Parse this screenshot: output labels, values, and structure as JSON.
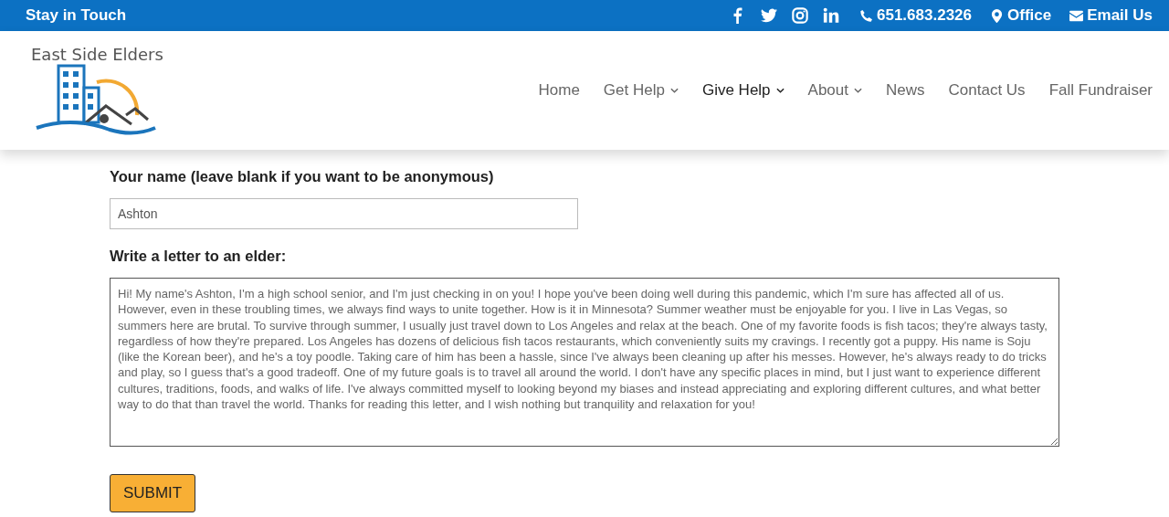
{
  "top_bar": {
    "title": "Stay in Touch",
    "social": [
      {
        "kind": "facebook"
      },
      {
        "kind": "twitter"
      },
      {
        "kind": "instagram"
      },
      {
        "kind": "linkedin"
      }
    ],
    "contacts": [
      {
        "kind": "phone",
        "label": "651.683.2326"
      },
      {
        "kind": "pin",
        "label": "Office"
      },
      {
        "kind": "mail",
        "label": "Email Us"
      }
    ]
  },
  "logo": {
    "text": "East Side Elders"
  },
  "nav": [
    {
      "label": "Home",
      "has_menu": false,
      "selected": false
    },
    {
      "label": "Get Help",
      "has_menu": true,
      "selected": false
    },
    {
      "label": "Give Help",
      "has_menu": true,
      "selected": true
    },
    {
      "label": "About",
      "has_menu": true,
      "selected": false
    },
    {
      "label": "News",
      "has_menu": false,
      "selected": false
    },
    {
      "label": "Contact Us",
      "has_menu": false,
      "selected": false
    },
    {
      "label": "Fall Fundraiser",
      "has_menu": false,
      "selected": false
    }
  ],
  "form": {
    "name_label": "Your name (leave blank if you want to be anonymous)",
    "name_value": "Ashton",
    "letter_label": "Write a letter to an elder:",
    "letter_value": "Hi! My name's Ashton, I'm a high school senior, and I'm just checking in on you! I hope you've been doing well during this pandemic, which I'm sure has affected all of us. However, even in these troubling times, we always find ways to unite together. How is it in Minnesota? Summer weather must be enjoyable for you. I live in Las Vegas, so summers here are brutal. To survive through summer, I usually just travel down to Los Angeles and relax at the beach. One of my favorite foods is fish tacos; they're always tasty, regardless of how they're prepared. Los Angeles has dozens of delicious fish tacos restaurants, which conveniently suits my cravings. I recently got a puppy. His name is Soju (like the Korean beer), and he's a toy poodle. Taking care of him has been a hassle, since I've always been cleaning up after his messes. However, he's always ready to do tricks and play, so I guess that's a good tradeoff. One of my future goals is to travel all around the world. I don't have any specific places in mind, but I just want to experience different cultures, traditions, foods, and walks of life. I've always committed myself to looking beyond my biases and instead appreciating and exploring different cultures, and what better way to do that than travel the world. Thanks for reading this letter, and I wish nothing but tranquility and relaxation for you!",
    "submit": "SUBMIT"
  }
}
